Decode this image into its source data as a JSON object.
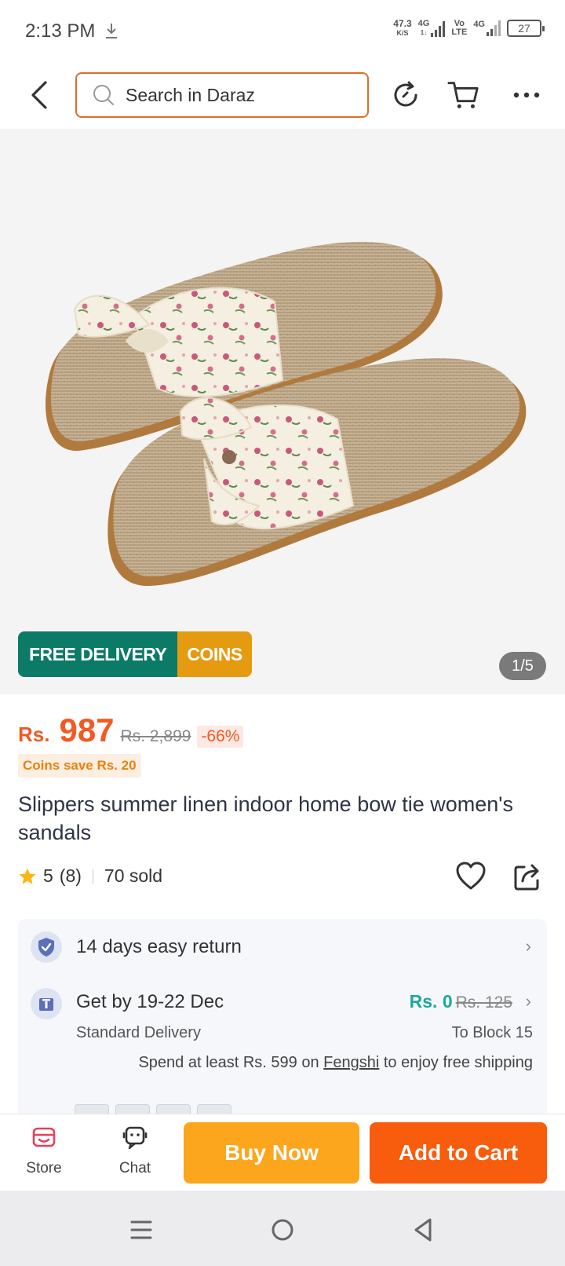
{
  "status_bar": {
    "time": "2:13 PM",
    "net_speed_value": "47.3",
    "net_speed_unit": "K/S",
    "sim1_label": "4G",
    "sim1_sub": "1↓",
    "volte_top": "Vo",
    "volte_bottom": "LTE",
    "sim2_label": "4G",
    "battery": "27"
  },
  "header": {
    "search_placeholder": "Search in Daraz"
  },
  "gallery": {
    "promo_free": "FREE DELIVERY",
    "promo_coins": "COINS",
    "counter": "1/5"
  },
  "price": {
    "currency": "Rs.",
    "current": "987",
    "original": "Rs. 2,899",
    "discount": "-66%",
    "coins_save": "Coins save Rs. 20"
  },
  "product": {
    "title": "Slippers summer linen indoor home bow tie women's sandals",
    "rating": "5",
    "reviews": "(8)",
    "sold": "70 sold"
  },
  "delivery": {
    "return_text": "14 days easy return",
    "delivery_date": "Get by 19-22 Dec",
    "fee_now": "Rs. 0",
    "fee_old": "Rs. 125",
    "method": "Standard Delivery",
    "destination": "To Block 15",
    "note_prefix": "Spend at least Rs. 599 on ",
    "note_store": "Fengshi",
    "note_suffix": " to enjoy free shipping"
  },
  "bottom_bar": {
    "store_label": "Store",
    "chat_label": "Chat",
    "buy_now": "Buy Now",
    "add_to_cart": "Add to Cart"
  },
  "colors": {
    "accent_orange": "#f15a22",
    "buy_now": "#fca61d",
    "add_to_cart": "#f75d0c",
    "free_delivery_green": "#0b7a66",
    "coins_yellow": "#e59b10"
  }
}
